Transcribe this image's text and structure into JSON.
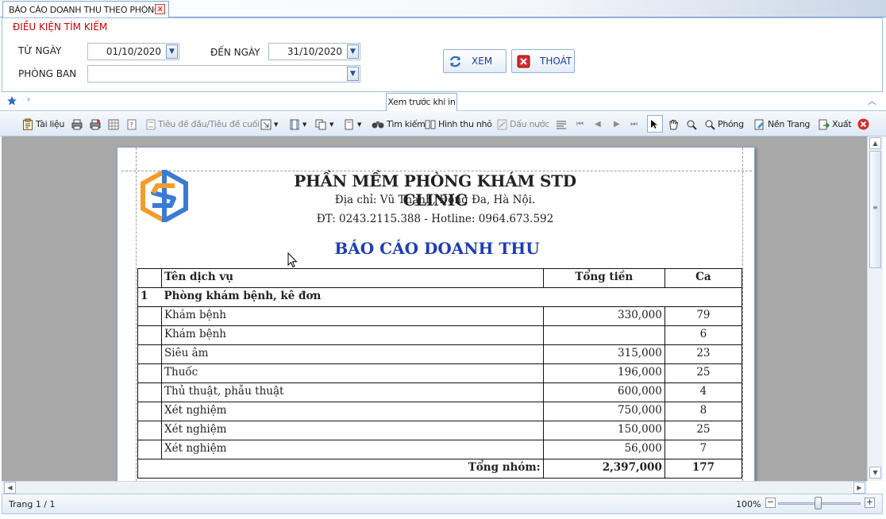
{
  "tab": {
    "title": "BÁO CÁO DOANH THU THEO PHÒNG",
    "close": "x"
  },
  "search": {
    "section_title": "ĐIỀU KIỆN TÌM KIẾM",
    "from_label": "TỪ NGÀY",
    "from_value": "01/10/2020",
    "to_label": "ĐẾN NGÀY",
    "to_value": "31/10/2020",
    "dept_label": "PHÒNG BAN",
    "dept_value": "",
    "view_button": "XEM",
    "exit_button": "THOÁT"
  },
  "ribbon": {
    "tab_label": "Xem trước khi in"
  },
  "toolbar": {
    "document": "Tài liệu",
    "header_footer": "Tiêu đề đầu/Tiêu đề cuối",
    "find": "Tìm kiếm",
    "thumbnails": "Hình thu nhỏ",
    "watermark": "Dấu nước",
    "zoom": "Phóng",
    "page_color": "Nền Trang",
    "export": "Xuất"
  },
  "report": {
    "clinic_name": "PHẦN MỀM PHÒNG KHÁM STD CLINIC",
    "address": "Địa chỉ: Vũ Thạnh, Đống Đa, Hà Nội.",
    "phone": "ĐT: 0243.2115.388 - Hotline: 0964.673.592",
    "title": "BÁO CÁO DOANH THU",
    "headers": [
      "",
      "Tên dịch vụ",
      "Tổng tiền",
      "Ca"
    ],
    "group": {
      "index": "1",
      "name": "Phòng khám bệnh, kê đơn"
    },
    "rows": [
      {
        "name": "Khám bệnh",
        "total": "330,000",
        "count": "79"
      },
      {
        "name": "Khám bệnh",
        "total": "",
        "count": "6"
      },
      {
        "name": "Siêu âm",
        "total": "315,000",
        "count": "23"
      },
      {
        "name": "Thuốc",
        "total": "196,000",
        "count": "25"
      },
      {
        "name": "Thủ thuật, phẫu thuật",
        "total": "600,000",
        "count": "4"
      },
      {
        "name": "Xét nghiệm",
        "total": "750,000",
        "count": "8"
      },
      {
        "name": "Xét nghiệm",
        "total": "150,000",
        "count": "25"
      },
      {
        "name": "Xét nghiệm",
        "total": "56,000",
        "count": "7"
      }
    ],
    "group_total": {
      "label": "Tổng nhóm:",
      "total": "2,397,000",
      "count": "177"
    }
  },
  "status": {
    "page": "Trang 1 / 1",
    "zoom": "100%"
  },
  "colors": {
    "accent_red": "#cc0000",
    "title_blue": "#1f3db3",
    "logo_orange": "#f39c2b",
    "logo_blue": "#3a7bd5"
  }
}
